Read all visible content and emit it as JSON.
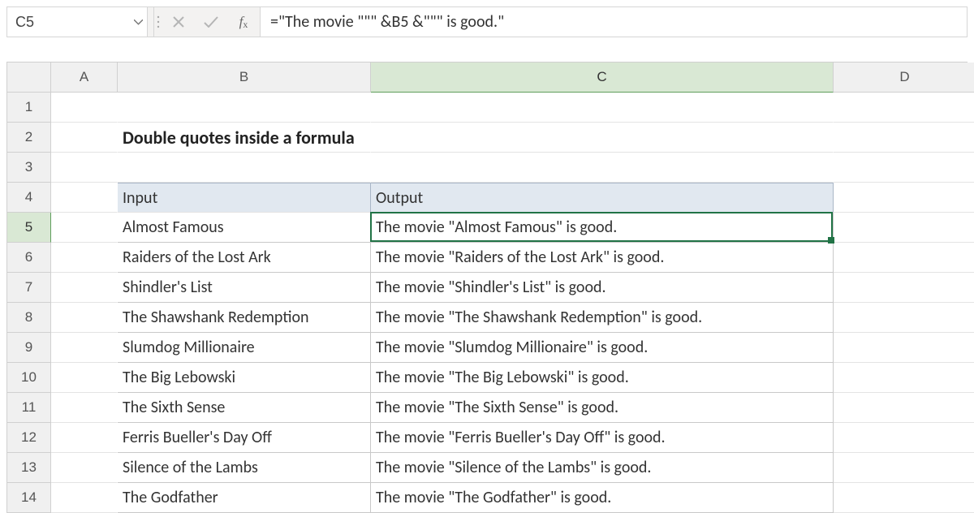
{
  "name_box": {
    "value": "C5"
  },
  "formula_bar": {
    "formula": "=\"The movie \"\"\" &B5 &\"\"\" is good.\""
  },
  "columns": [
    "A",
    "B",
    "C",
    "D"
  ],
  "row_numbers": [
    "1",
    "2",
    "3",
    "4",
    "5",
    "6",
    "7",
    "8",
    "9",
    "10",
    "11",
    "12",
    "13",
    "14"
  ],
  "title": "Double quotes inside a formula",
  "table": {
    "headers": {
      "input": "Input",
      "output": "Output"
    },
    "rows": [
      {
        "input": "Almost Famous",
        "output": "The movie \"Almost Famous\" is good."
      },
      {
        "input": "Raiders of the Lost Ark",
        "output": "The movie \"Raiders of the Lost Ark\" is good."
      },
      {
        "input": "Shindler's List",
        "output": "The movie \"Shindler's List\" is good."
      },
      {
        "input": "The Shawshank Redemption",
        "output": "The movie \"The Shawshank Redemption\" is good."
      },
      {
        "input": "Slumdog Millionaire",
        "output": "The movie \"Slumdog Millionaire\" is good."
      },
      {
        "input": "The Big Lebowski",
        "output": "The movie \"The Big Lebowski\" is good."
      },
      {
        "input": "The Sixth Sense",
        "output": "The movie \"The Sixth Sense\" is good."
      },
      {
        "input": "Ferris Bueller's Day Off",
        "output": "The movie \"Ferris Bueller's Day Off\" is good."
      },
      {
        "input": "Silence of the Lambs",
        "output": "The movie \"Silence of the Lambs\" is good."
      },
      {
        "input": "The Godfather",
        "output": "The movie \"The Godfather\" is good."
      }
    ]
  },
  "selected": {
    "col": "C",
    "row": "5"
  }
}
